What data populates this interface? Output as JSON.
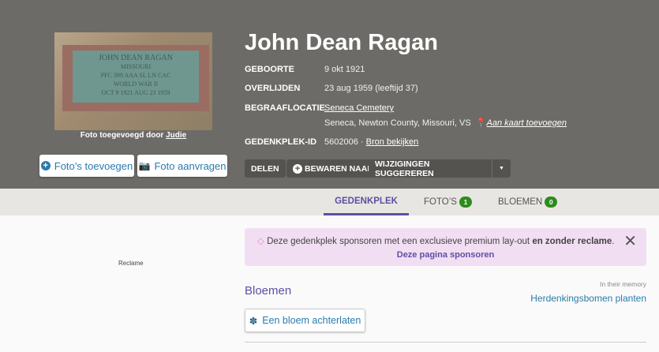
{
  "photo": {
    "plate_lines": [
      "JOHN DEAN RAGAN",
      "MISSOURI",
      "PFC 399 AAA SL LN CAC",
      "WORLD WAR II",
      "OCT 9 1921   AUG 23 1959"
    ],
    "caption_prefix": "Foto toegevoegd door",
    "caption_author": "Judie"
  },
  "photo_buttons": {
    "add": "Foto’s toevoegen",
    "request": "Foto aanvragen"
  },
  "person": {
    "name": "John Dean Ragan"
  },
  "facts": {
    "birth_label": "GEBOORTE",
    "birth": "9 okt 1921",
    "death_label": "OVERLIJDEN",
    "death": "23 aug 1959 (leeftijd 37)",
    "burial_label": "BEGRAAFLOCATIE",
    "cemetery": "Seneca Cemetery",
    "location": "Seneca, Newton County, Missouri, VS",
    "map_link": "Aan kaart toevoegen",
    "id_label": "GEDENKPLEK-ID",
    "id": "5602006 ·",
    "source_link": "Bron bekijken"
  },
  "actions": {
    "share": "DELEN",
    "save": "BEWAREN NAAR",
    "suggest": "WIJZIGINGEN SUGGEREREN"
  },
  "tabs": [
    {
      "label": "GEDENKPLEK"
    },
    {
      "label": "FOTO’S",
      "count": "1"
    },
    {
      "label": "BLOEMEN",
      "count": "0"
    }
  ],
  "ad": {
    "label": "Reclame"
  },
  "banner": {
    "text": "Deze gedenkplek sponsoren met een exclusieve premium lay-out",
    "bold": "en zonder reclame",
    "end": ".",
    "link": "Deze pagina sponsoren"
  },
  "flowers": {
    "title": "Bloemen",
    "memory": "In their memory",
    "trees": "Herdenkingsbomen planten",
    "button": "Een bloem achterlaten"
  },
  "colors": {
    "header": "#6d6b67",
    "accent": "#5e4fa2",
    "link": "#2a7bab",
    "badge": "#2e8b1e"
  }
}
